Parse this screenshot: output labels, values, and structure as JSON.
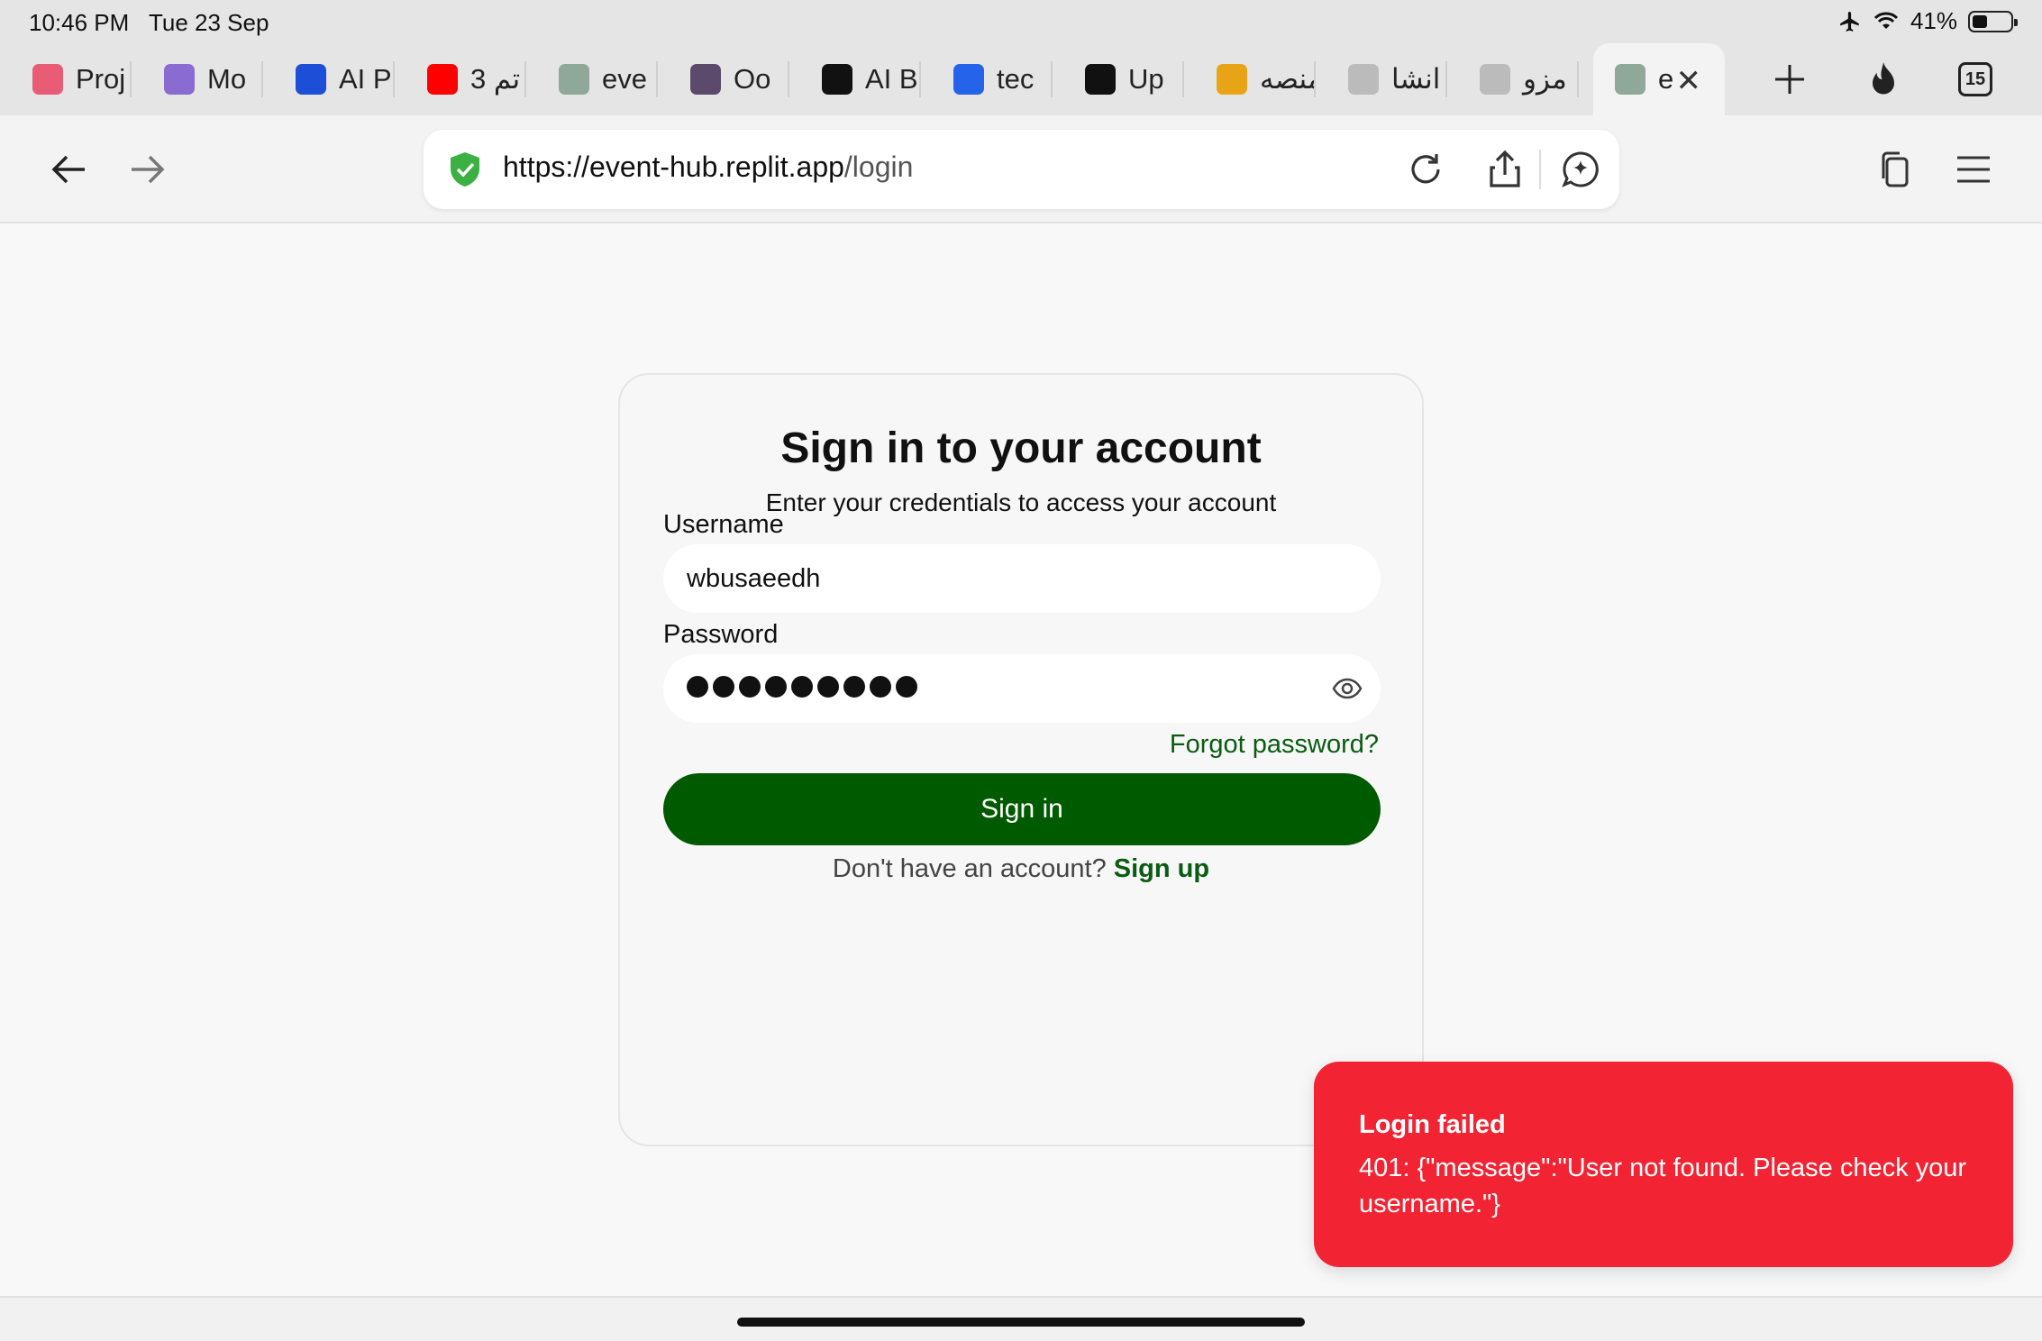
{
  "status": {
    "time": "10:46 PM",
    "date": "Tue 23 Sep",
    "battery": "41%",
    "battery_level": 0.41
  },
  "tabs": [
    {
      "label": "Proj",
      "icon": "project-favicon",
      "color": "#e85d75"
    },
    {
      "label": "Mo",
      "icon": "brain-favicon",
      "color": "#8a6bd1"
    },
    {
      "label": "AI P",
      "icon": "pm-favicon",
      "color": "#1d4ed8"
    },
    {
      "label": "3 تم",
      "icon": "youtube-favicon",
      "color": "#ff0000"
    },
    {
      "label": "eve",
      "icon": "ev-favicon",
      "color": "#8fa89a"
    },
    {
      "label": "Oo",
      "icon": "op-favicon",
      "color": "#5b4a6b"
    },
    {
      "label": "AI B",
      "icon": "rocket-favicon",
      "color": "#111111"
    },
    {
      "label": "tec",
      "icon": "tech-favicon",
      "color": "#2563eb"
    },
    {
      "label": "Up",
      "icon": "upwork-favicon",
      "color": "#111111"
    },
    {
      "label": "منصه",
      "icon": "palm-favicon",
      "color": "#e8a317"
    },
    {
      "label": "انشا",
      "icon": "generic-favicon",
      "color": "#bbbbbb"
    },
    {
      "label": "مزو",
      "icon": "generic-favicon",
      "color": "#bbbbbb"
    },
    {
      "label": "e",
      "icon": "ev-favicon",
      "color": "#8fa89a",
      "active": true
    }
  ],
  "tab_count": "15",
  "address": {
    "domain": "https://event-hub.replit.app",
    "path": "/login"
  },
  "login": {
    "title": "Sign in to your account",
    "subtitle": "Enter your credentials to access your account",
    "username_label": "Username",
    "username_value": "wbusaeedh",
    "password_label": "Password",
    "password_length": 9,
    "forgot": "Forgot password?",
    "submit": "Sign in",
    "no_account": "Don't have an account?",
    "signup": "Sign up"
  },
  "toast": {
    "title": "Login failed",
    "message": "401: {\"message\":\"User not found. Please check your username.\"}"
  },
  "colors": {
    "primary": "#005a00",
    "link": "#0a5c12",
    "error": "#f22333"
  }
}
